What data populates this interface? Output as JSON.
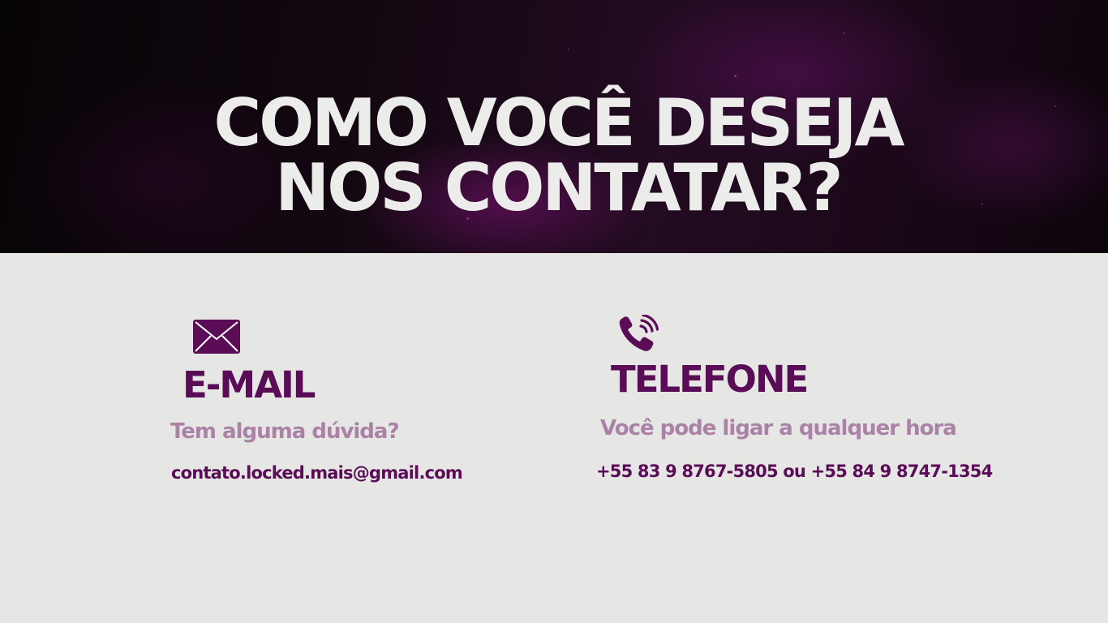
{
  "hero": {
    "title_line1": "COMO VOCÊ DESEJA",
    "title_line2": "NOS CONTATAR?"
  },
  "email": {
    "icon": "envelope-icon",
    "heading": "E-MAIL",
    "subtitle": "Tem alguma dúvida?",
    "address": "contato.locked.mais@gmail.com"
  },
  "phone": {
    "icon": "phone-ringing-icon",
    "heading": "TELEFONE",
    "subtitle": "Você pode ligar a qualquer hora",
    "numbers": "+55 83 9 8767-5805 ou +55 84 9 8747-1354"
  },
  "colors": {
    "brand_purple": "#5a0d56",
    "muted_purple": "#a982a6",
    "background": "#e6e6e5",
    "hero_text": "#ececeb"
  }
}
